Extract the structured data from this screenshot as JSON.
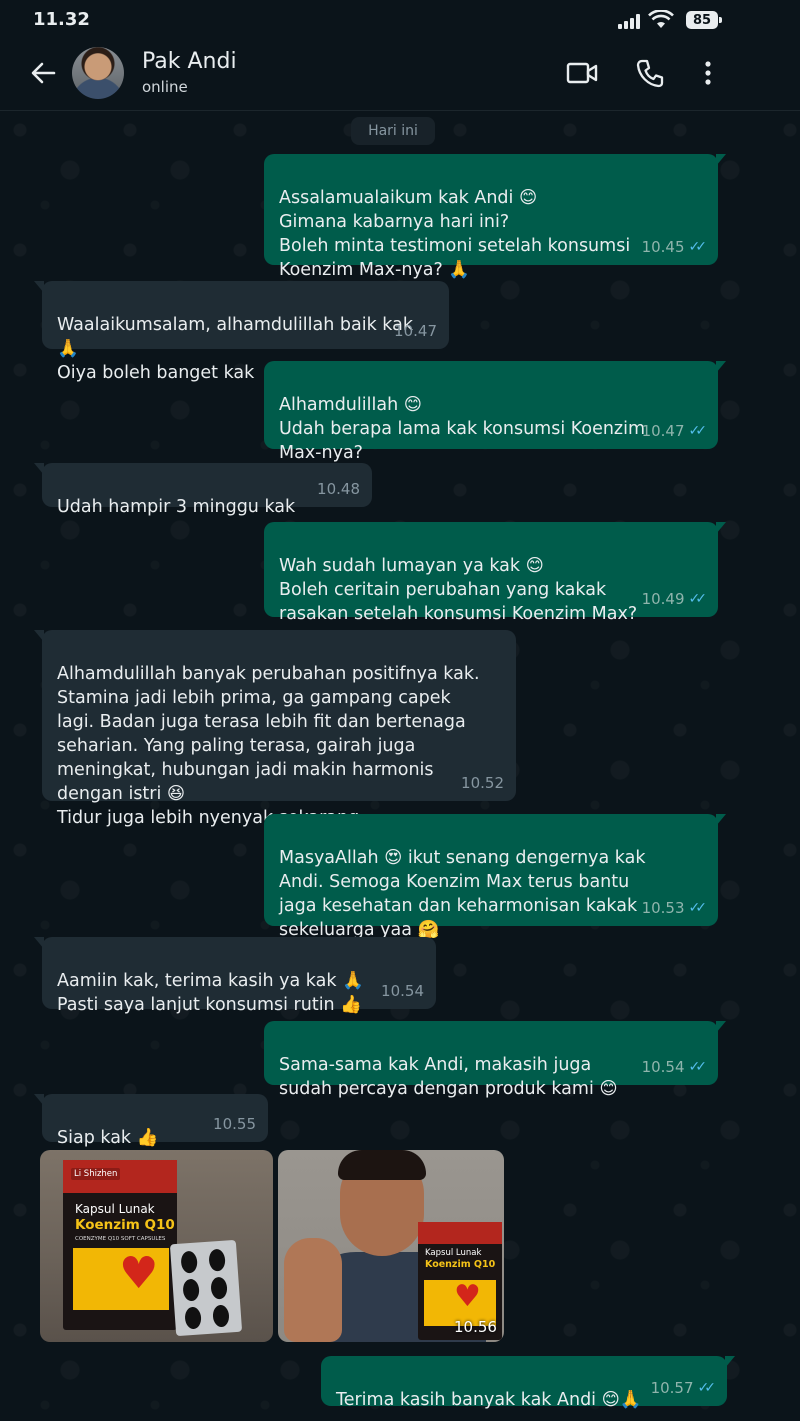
{
  "status": {
    "time": "11.32",
    "battery": "85"
  },
  "contact": {
    "name": "Pak Andi",
    "status": "online"
  },
  "date_chip": "Hari ini",
  "messages": [
    {
      "dir": "out",
      "text": "Assalamualaikum kak Andi 😊\nGimana kabarnya hari ini?\nBoleh minta testimoni setelah konsumsi\nKoenzim Max-nya? 🙏",
      "time": "10.45",
      "read": "✓✓"
    },
    {
      "dir": "in",
      "text": "Waalaikumsalam, alhamdulillah baik kak 🙏\nOiya boleh banget kak",
      "time": "10.47"
    },
    {
      "dir": "out",
      "text": "Alhamdulillah 😊\nUdah berapa lama kak konsumsi Koenzim\nMax-nya?",
      "time": "10.47",
      "read": "✓✓"
    },
    {
      "dir": "in",
      "text": "Udah hampir 3 minggu kak",
      "time": "10.48"
    },
    {
      "dir": "out",
      "text": "Wah sudah lumayan ya kak 😊\nBoleh ceritain perubahan yang kakak\nrasakan setelah konsumsi Koenzim Max?",
      "time": "10.49",
      "read": "✓✓"
    },
    {
      "dir": "in",
      "text": "Alhamdulillah banyak perubahan positifnya kak.\nStamina jadi lebih prima, ga gampang capek\nlagi. Badan juga terasa lebih fit dan bertenaga\nseharian. Yang paling terasa, gairah juga\nmeningkat, hubungan jadi makin harmonis\ndengan istri 😆\nTidur juga lebih nyenyak sekarang.",
      "time": "10.52"
    },
    {
      "dir": "out",
      "text": "MasyaAllah 😍 ikut senang dengernya kak\nAndi. Semoga Koenzim Max terus bantu\njaga kesehatan dan keharmonisan kakak\nsekeluarga yaa 🤗",
      "time": "10.53",
      "read": "✓✓"
    },
    {
      "dir": "in",
      "text": "Aamiin kak, terima kasih ya kak 🙏\nPasti saya lanjut konsumsi rutin 👍",
      "time": "10.54"
    },
    {
      "dir": "out",
      "text": "Sama-sama kak Andi, makasih juga\nsudah percaya dengan produk kami 😊",
      "time": "10.54",
      "read": "✓✓"
    },
    {
      "dir": "in",
      "text": "Siap kak 👍",
      "time": "10.55"
    },
    {
      "dir": "out",
      "text": "Terima kasih banyak kak Andi 😊🙏",
      "time": "10.57",
      "read": "✓✓"
    }
  ],
  "photos": {
    "time": "10.56",
    "box": {
      "brand": "Li Shizhen",
      "line1": "Kapsul Lunak",
      "line2": "Koenzim Q10",
      "line3": "COENZYME Q10 SOFT CAPSULES"
    }
  },
  "colors": {
    "background": "#0b141a",
    "outgoing_bubble": "#005c4b",
    "incoming_bubble": "#1f2c34",
    "read_ticks": "#53bdeb"
  },
  "icons": [
    "back-arrow-icon",
    "video-call-icon",
    "phone-icon",
    "more-menu-icon",
    "signal-icon",
    "wifi-icon",
    "battery-icon"
  ]
}
